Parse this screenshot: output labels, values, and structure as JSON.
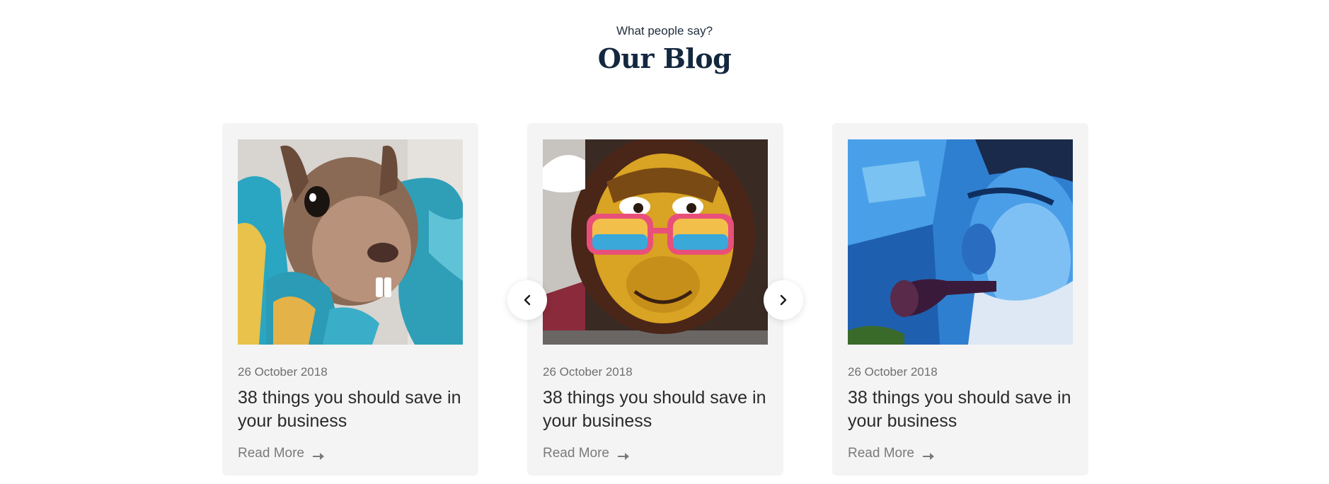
{
  "header": {
    "eyebrow": "What people say?",
    "title": "Our Blog"
  },
  "carousel": {
    "prev_icon": "chevron-left-icon",
    "next_icon": "chevron-right-icon"
  },
  "posts": [
    {
      "image": "squirrel-graffiti",
      "date": "26 October 2018",
      "title": "38 things you should save in your business",
      "read_more": "Read More",
      "icon": "arrow-right-icon"
    },
    {
      "image": "monkey-graffiti",
      "date": "26 October 2018",
      "title": "38 things you should save in your business",
      "read_more": "Read More",
      "icon": "arrow-right-icon"
    },
    {
      "image": "old-man-graffiti",
      "date": "26 October 2018",
      "title": "38 things you should save in your business",
      "read_more": "Read More",
      "icon": "arrow-right-icon"
    }
  ],
  "colors": {
    "title": "#13283f",
    "card_bg": "#f4f4f4",
    "muted_text": "#6f6f6f"
  }
}
